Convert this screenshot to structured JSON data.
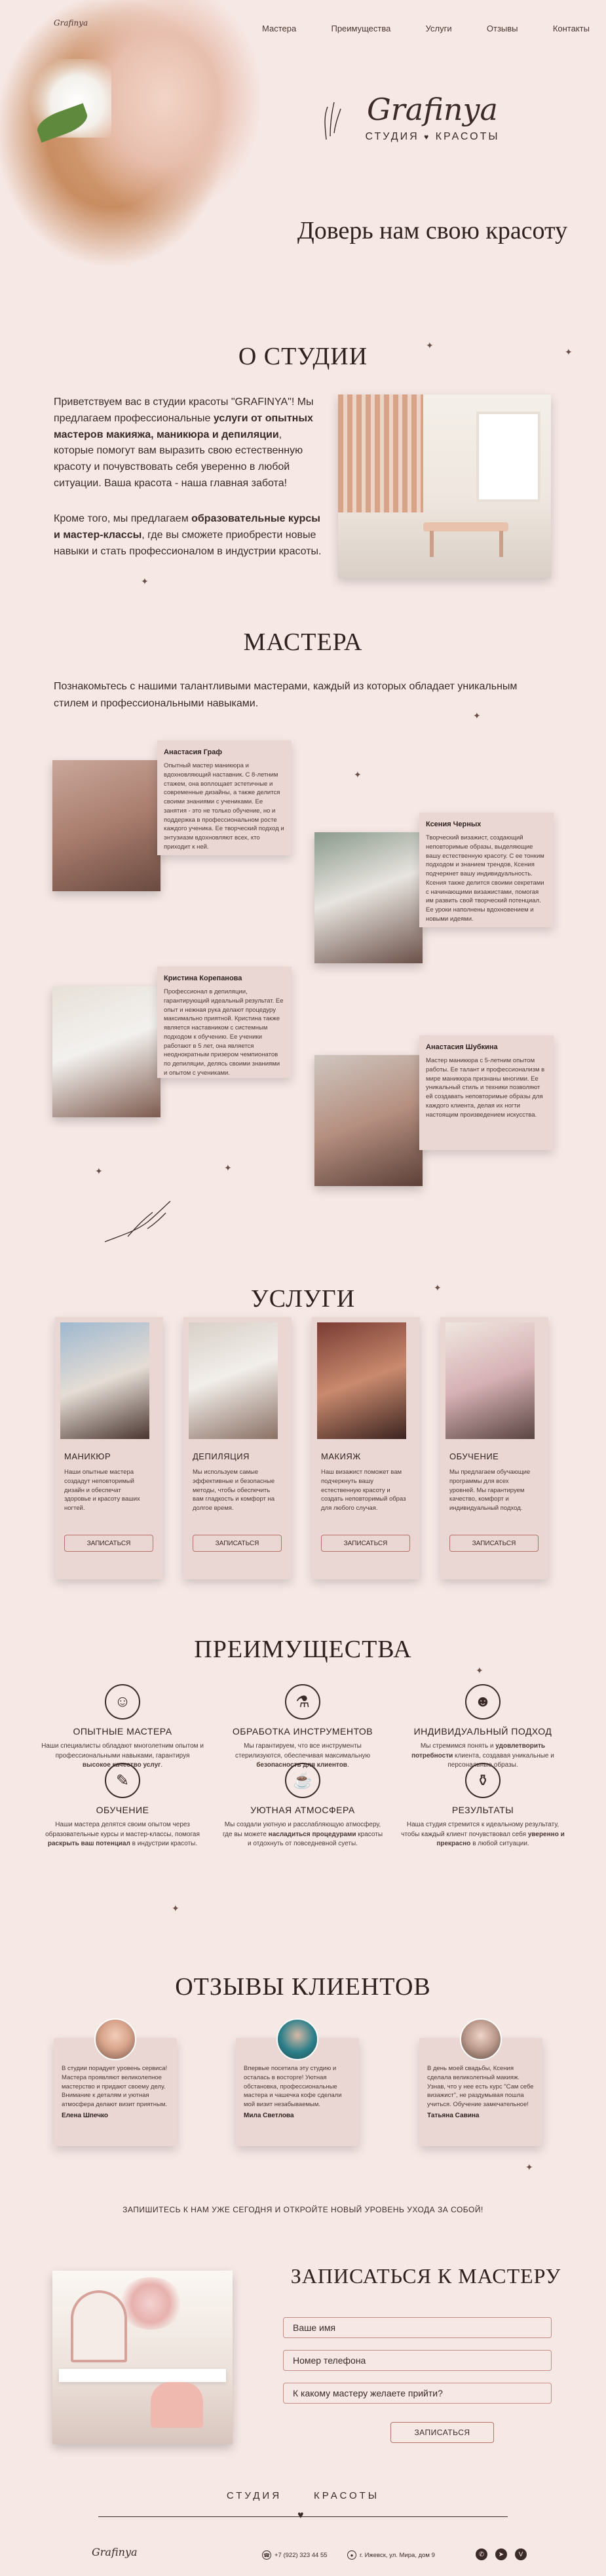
{
  "header": {
    "small_logo": "Grafinya",
    "nav": [
      "Мастера",
      "Преимущества",
      "Услуги",
      "Отзывы",
      "Контакты"
    ],
    "brand_name": "Grafinya",
    "brand_sub_left": "СТУДИЯ",
    "brand_sub_right": "КРАСОТЫ",
    "tagline": "Доверь нам свою красоту"
  },
  "about": {
    "title": "О СТУДИИ",
    "p1_a": "Приветствуем вас в студии красоты \"GRAFINYA\"! Мы предлагаем профессиональные ",
    "p1_b": "услуги от опытных мастеров макияжа, маникюра и депиляции",
    "p1_c": ", которые помогут вам выразить свою естественную красоту и почувствовать себя уверенно в любой ситуации. Ваша красота - наша главная забота!",
    "p2_a": "Кроме того, мы предлагаем ",
    "p2_b": "образовательные курсы и мастер-классы",
    "p2_c": ", где вы сможете приобрести новые навыки и стать профессионалом в индустрии красоты."
  },
  "masters": {
    "title": "МАСТЕРА",
    "intro": "Познакомьтесь с нашими талантливыми мастерами, каждый из которых обладает уникальным стилем и профессиональными навыками.",
    "items": [
      {
        "name": "Анастасия Граф",
        "desc": "Опытный мастер маникюра и вдохновляющий наставник. С 8-летним стажем, она воплощает эстетичные и современные дизайны, а также делится своими знаниями с учениками. Ее занятия - это не только обучение, но и поддержка в профессиональном росте каждого ученика. Ее творческий подход и энтузиазм вдохновляют всех, кто приходит к ней."
      },
      {
        "name": "Ксения Черных",
        "desc": "Творческий визажист, создающий неповторимые образы, выделяющие вашу естественную красоту. С ее тонким подходом и знанием трендов, Ксения подчеркнет вашу индивидуальность. Ксения также делится своими секретами с начинающими визажистами, помогая им развить свой творческий потенциал. Ее уроки наполнены вдохновением и новыми идеями."
      },
      {
        "name": "Кристина Корепанова",
        "desc": "Профессионал в депиляции, гарантирующий идеальный результат. Ее опыт и нежная рука делают процедуру максимально приятной. Кристина также является наставником с системным подходом к обучению. Ее ученики работают в 5 лет, она является неоднократным призером чемпионатов по депиляции, делясь своими знаниями и опытом с учениками."
      },
      {
        "name": "Анастасия Шубкина",
        "desc": "Мастер маникюра с 5-летним опытом работы. Ее талант и профессионализм в мире маникюра признаны многими. Ее уникальный стиль и техники позволяют ей создавать неповторимые образы для каждого клиента, делая их ногти настоящим произведением искусства."
      }
    ]
  },
  "services": {
    "title": "УСЛУГИ",
    "button_label": "ЗАПИСАТЬСЯ",
    "items": [
      {
        "title": "МАНИКЮР",
        "desc": "Наши опытные мастера создадут неповторимый дизайн и обеспечат здоровье и красоту ваших ногтей."
      },
      {
        "title": "ДЕПИЛЯЦИЯ",
        "desc": "Мы используем самые эффективные и безопасные методы, чтобы обеспечить вам гладкость и комфорт на долгое время."
      },
      {
        "title": "МАКИЯЖ",
        "desc": "Наш визажист поможет вам подчеркнуть вашу естественную красоту и создать неповторимый образ для любого случая."
      },
      {
        "title": "ОБУЧЕНИЕ",
        "desc": "Мы предлагаем обучающие программы для всех уровней. Мы гарантируем качество, комфорт и индивидуальный подход."
      }
    ]
  },
  "advantages": {
    "title": "ПРЕИМУЩЕСТВА",
    "items": [
      {
        "icon": "master-icon",
        "glyph": "☺",
        "title": "ОПЫТНЫЕ МАСТЕРА",
        "desc_a": "Наши специалисты обладают многолетним опытом и профессиональными навыками, гарантируя ",
        "desc_b": "высокое качество услуг",
        "desc_c": "."
      },
      {
        "icon": "bottle-icon",
        "glyph": "⚗",
        "title": "ОБРАБОТКА ИНСТРУМЕНТОВ",
        "desc_a": "Мы гарантируем, что все инструменты стерилизуются, обеспечивая максимальную ",
        "desc_b": "безопасность для клиентов",
        "desc_c": "."
      },
      {
        "icon": "profile-icon",
        "glyph": "☻",
        "title": "ИНДИВИДУАЛЬНЫЙ ПОДХОД",
        "desc_a": "Мы стремимся понять и ",
        "desc_b": "удовлетворить потребности",
        "desc_c": " клиента, создавая уникальные и персональные образы."
      },
      {
        "icon": "education-icon",
        "glyph": "✎",
        "title": "ОБУЧЕНИЕ",
        "desc_a": "Наши мастера делятся своим опытом через образовательные курсы и мастер-классы, помогая ",
        "desc_b": "раскрыть ваш потенциал",
        "desc_c": " в индустрии красоты."
      },
      {
        "icon": "cup-icon",
        "glyph": "☕",
        "title": "УЮТНАЯ АТМОСФЕРА",
        "desc_a": "Мы создали уютную и расслабляющую атмосферу, где вы можете ",
        "desc_b": "насладиться процедурами",
        "desc_c": " красоты и отдохнуть от повседневной суеты."
      },
      {
        "icon": "bottles-icon",
        "glyph": "⚱",
        "title": "РЕЗУЛЬТАТЫ",
        "desc_a": "Наша студия стремится к идеальному результату, чтобы каждый клиент почувствовал себя ",
        "desc_b": "уверенно и прекрасно",
        "desc_c": " в любой ситуации."
      }
    ]
  },
  "reviews": {
    "title": "ОТЗЫВЫ КЛИЕНТОВ",
    "items": [
      {
        "text": "В студии порадует уровень сервиса! Мастера проявляют великолепное мастерство и придают своему делу. Внимание к деталям и уютная атмосфера делают визит приятным.",
        "author": "Елена Шпечко"
      },
      {
        "text": "Впервые посетила эту студию и осталась в восторге! Уютная обстановка, профессиональные мастера и чашечка кофе сделали мой визит незабываемым.",
        "author": "Мила Светлова"
      },
      {
        "text": "В день моей свадьбы, Ксения сделала великолепный макияж. Узнав, что у нее есть курс \"Сам себе визажист\", не раздумывая пошла учиться. Обучение замечательное!",
        "author": "Татьяна Савина"
      }
    ]
  },
  "cta": "ЗАПИШИТЕСЬ К НАМ УЖЕ СЕГОДНЯ И ОТКРОЙТЕ НОВЫЙ УРОВЕНЬ УХОДА ЗА СОБОЙ!",
  "booking": {
    "title": "ЗАПИСАТЬСЯ К МАСТЕРУ",
    "name_placeholder": "Ваше имя",
    "phone_placeholder": "Номер телефона",
    "master_placeholder": "К какому мастеру желаете прийти?",
    "submit": "ЗАПИСАТЬСЯ"
  },
  "footer": {
    "sub_left": "СТУДИЯ",
    "sub_right": "КРАСОТЫ",
    "logo": "Grafinya",
    "phone": "+7 (922) 323 44 55",
    "address": "г. Ижевск, ул. Мира, дом 9",
    "socials": [
      "whatsapp",
      "telegram",
      "vk"
    ]
  }
}
